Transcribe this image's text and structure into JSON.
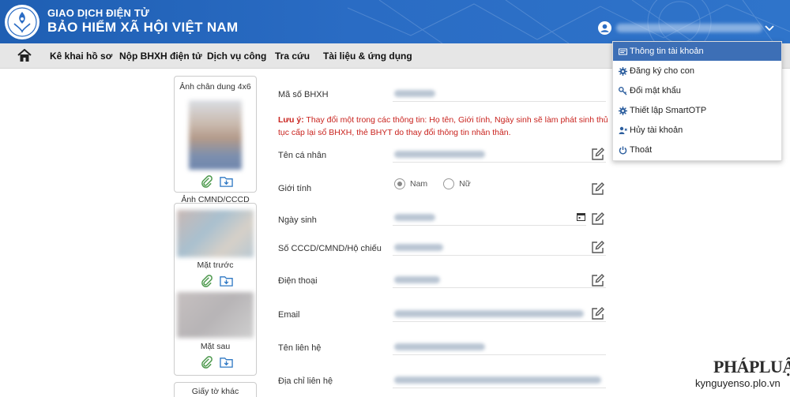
{
  "header": {
    "org_top": "GIAO DỊCH ĐIỆN TỬ",
    "org_main": "BẢO HIỂM XÃ HỘI VIỆT NAM",
    "logo_icon": "vss-logo",
    "user_icon": "user-circle-icon",
    "chevron_icon": "chevron-down-icon"
  },
  "nav": {
    "home_icon": "home-icon",
    "items": [
      "Kê khai hồ sơ",
      "Nộp BHXH điện tử",
      "Dịch vụ công",
      "Tra cứu",
      "Tài liệu & ứng dụng"
    ]
  },
  "left_panel": {
    "portrait_title": "Ảnh chân dung 4x6",
    "id_title": "Ảnh CMND/CCCD",
    "front_label": "Mặt trước",
    "back_label": "Mặt sau",
    "other_title": "Giấy tờ khác"
  },
  "form": {
    "bhxh_label": "Mã số BHXH",
    "notice_bold": "Lưu ý:",
    "notice_text": " Thay đổi một trong các thông tin: Họ tên, Giới tính, Ngày sinh sẽ làm phát sinh thủ tục cấp lại sổ BHXH, thẻ BHYT do thay đổi thông tin nhân thân.",
    "name_label": "Tên cá nhân",
    "gender_label": "Giới tính",
    "gender_male": "Nam",
    "gender_female": "Nữ",
    "dob_label": "Ngày sinh",
    "id_label": "Số CCCD/CMND/Hộ chiếu",
    "phone_label": "Điện thoại",
    "email_label": "Email",
    "contact_name_label": "Tên liên hệ",
    "contact_addr_label": "Địa chỉ liên hệ"
  },
  "dropdown": {
    "items": [
      {
        "label": "Thông tin tài khoản",
        "icon": "id-card-icon"
      },
      {
        "label": "Đăng ký cho con",
        "icon": "gear-icon"
      },
      {
        "label": "Đổi mật khẩu",
        "icon": "key-icon"
      },
      {
        "label": "Thiết lập SmartOTP",
        "icon": "gear-icon"
      },
      {
        "label": "Hủy tài khoản",
        "icon": "user-x-icon"
      },
      {
        "label": "Thoát",
        "icon": "power-icon"
      }
    ]
  },
  "watermark": {
    "brand": "PHÁPLUẬT",
    "url": "kynguyenso.plo.vn"
  },
  "colors": {
    "header_blue": "#2a6cc4",
    "notice_red": "#c9231e",
    "dropdown_active": "#3d6fb6"
  }
}
